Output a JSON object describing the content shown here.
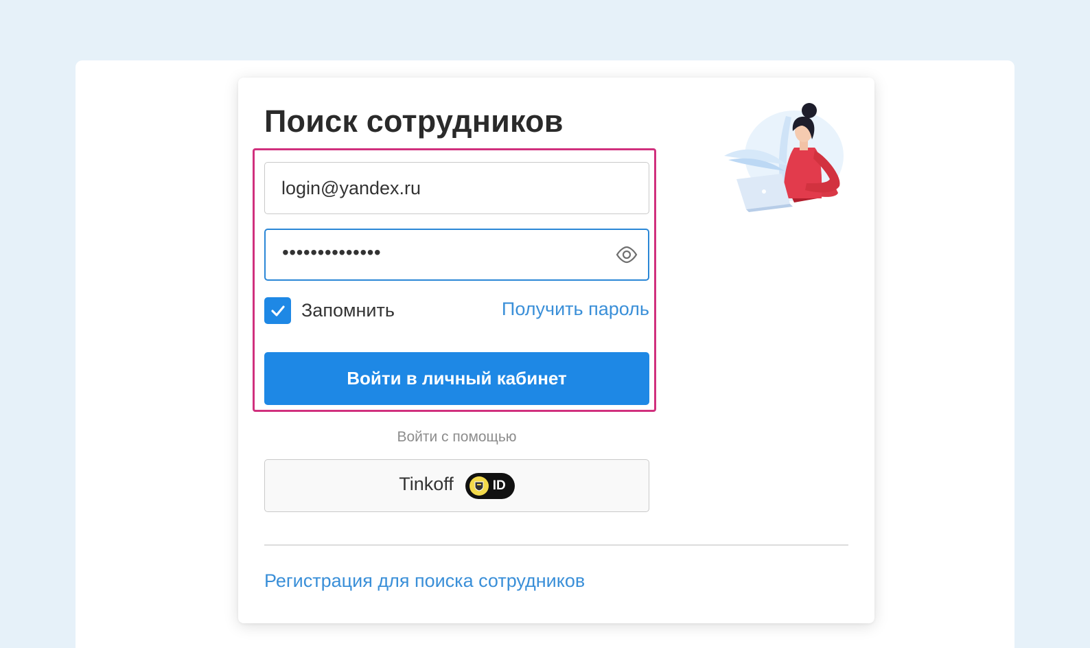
{
  "form": {
    "title": "Поиск сотрудников",
    "login_value": "login@yandex.ru",
    "password_mask": "••••••••••••••",
    "remember_label": "Запомнить",
    "remember_checked": true,
    "get_password_link": "Получить пароль",
    "submit_label": "Войти в личный кабинет",
    "alt_login_caption": "Войти с помощью",
    "tinkoff_label": "Tinkoff",
    "tinkoff_badge_text": "ID",
    "register_link": "Регистрация для поиска сотрудников"
  },
  "icons": {
    "password_toggle": "eye-icon",
    "checkbox": "checkmark-icon",
    "tinkoff": "tinkoff-id-badge",
    "illustration": "woman-with-laptop-illustration"
  },
  "colors": {
    "primary": "#1e88e5",
    "link": "#3a8fd8",
    "highlight": "#d0307d",
    "page_background": "#e6f1f9"
  }
}
